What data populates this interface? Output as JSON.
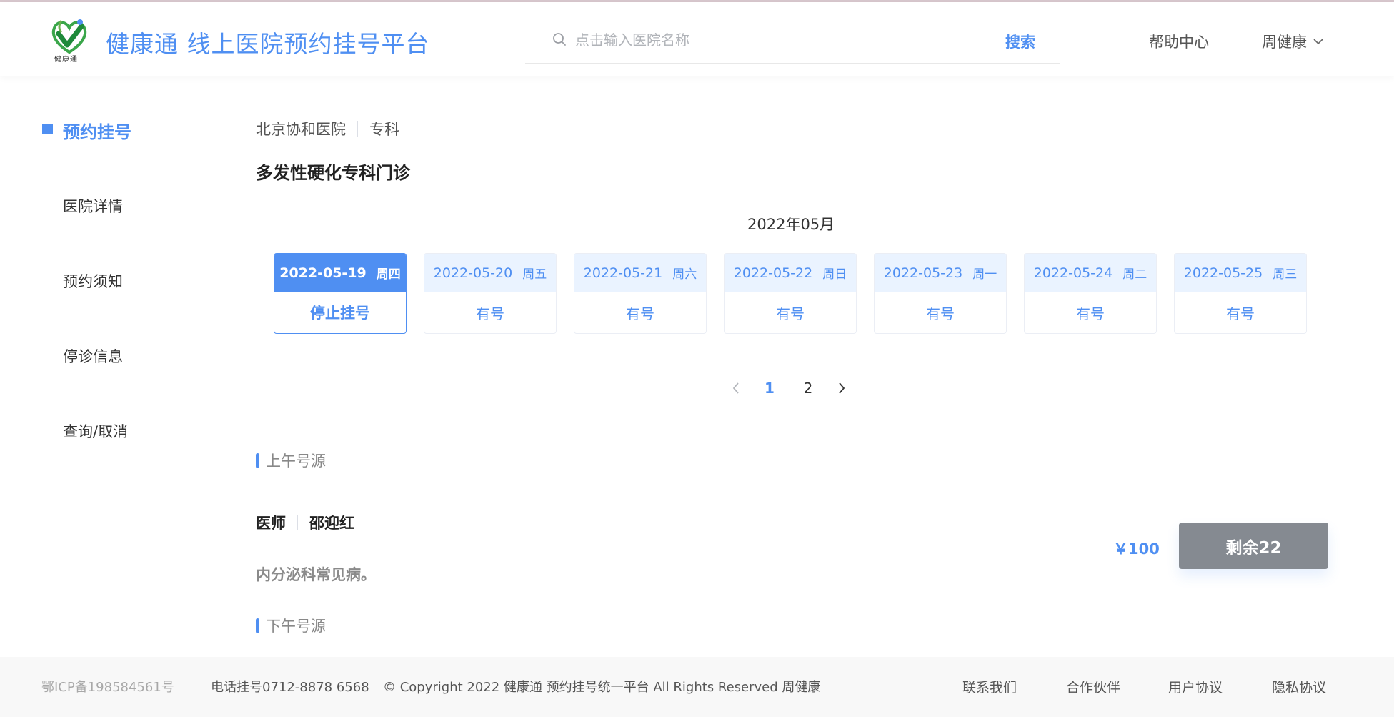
{
  "header": {
    "logo_caption": "健康通",
    "brand_title": "健康通 线上医院预约挂号平台",
    "search": {
      "placeholder": "点击输入医院名称",
      "value": "",
      "button_label": "搜索"
    },
    "help_label": "帮助中心",
    "user_name": "周健康"
  },
  "sidebar": {
    "items": [
      {
        "label": "预约挂号",
        "active": true
      },
      {
        "label": "医院详情"
      },
      {
        "label": "预约须知"
      },
      {
        "label": "停诊信息"
      },
      {
        "label": "查询/取消"
      }
    ]
  },
  "main": {
    "breadcrumb": {
      "hospital": "北京协和医院",
      "category": "专科"
    },
    "department_title": "多发性硬化专科门诊",
    "month_label": "2022年05月",
    "dates": [
      {
        "date": "2022-05-19",
        "weekday": "周四",
        "status": "停止挂号",
        "selected": true
      },
      {
        "date": "2022-05-20",
        "weekday": "周五",
        "status": "有号"
      },
      {
        "date": "2022-05-21",
        "weekday": "周六",
        "status": "有号"
      },
      {
        "date": "2022-05-22",
        "weekday": "周日",
        "status": "有号"
      },
      {
        "date": "2022-05-23",
        "weekday": "周一",
        "status": "有号"
      },
      {
        "date": "2022-05-24",
        "weekday": "周二",
        "status": "有号"
      },
      {
        "date": "2022-05-25",
        "weekday": "周三",
        "status": "有号"
      }
    ],
    "pagination": {
      "pages": [
        "1",
        "2"
      ],
      "current": "1"
    },
    "morning_label": "上午号源",
    "afternoon_label": "下午号源",
    "slot": {
      "title_label": "医师",
      "doctor_name": "邵迎红",
      "specialty": "内分泌科常见病。",
      "price": "￥100",
      "remaining_label": "剩余22"
    }
  },
  "footer": {
    "icp": "鄂ICP备198584561号",
    "phone": "电话挂号0712-8878 6568",
    "copyright": "© Copyright 2022 健康通 预约挂号统一平台 All Rights Reserved 周健康",
    "links": [
      "联系我们",
      "合作伙伴",
      "用户协议",
      "隐私协议"
    ]
  },
  "colors": {
    "accent": "#4f8ff2",
    "accent_light": "#eaf3ff",
    "button_gray": "#858a91",
    "footer_bg": "#f8f8f8"
  }
}
